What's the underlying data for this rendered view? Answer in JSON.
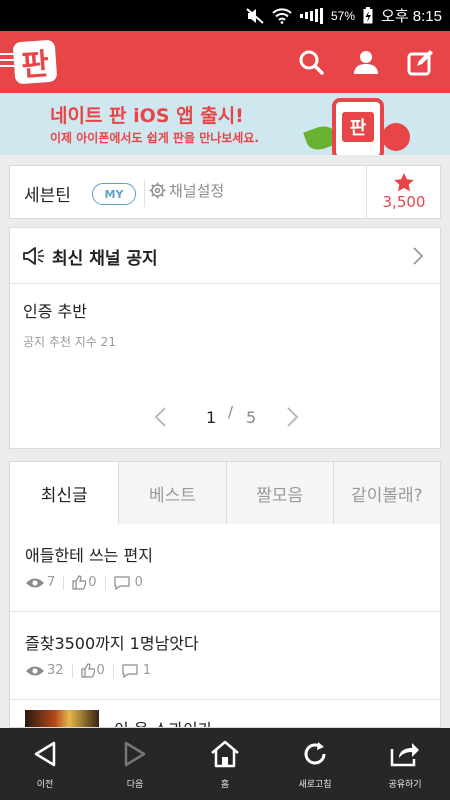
{
  "status_bar": {
    "battery_percent": "57%",
    "time": "오후 8:15",
    "icons": [
      "mute-icon",
      "wifi-icon",
      "signal-icon",
      "battery-charging-icon"
    ]
  },
  "header": {
    "logo_text": "판",
    "icons": [
      "menu-icon",
      "search-icon",
      "user-icon",
      "write-icon"
    ],
    "accent_color": "#e84548"
  },
  "banner": {
    "title": "네이트 판 iOS 앱 출시!",
    "subtitle": "이제 아이폰에서도 쉽게 판을 만나보세요.",
    "phone_logo_text": "판",
    "background_color": "#cfe7ee"
  },
  "channel": {
    "name": "세븐틴",
    "my_badge": "MY",
    "settings_label": "채널설정",
    "favorite_count": "3,500"
  },
  "notice": {
    "title": "최신 채널 공지",
    "post_title": "인증 추반",
    "post_meta": "공지 추천 지수 21",
    "page_current": "1",
    "page_separator": "/",
    "page_total": "5"
  },
  "tabs": [
    {
      "label": "최신글",
      "active": true
    },
    {
      "label": "베스트",
      "active": false
    },
    {
      "label": "짤모음",
      "active": false
    },
    {
      "label": "같이볼래?",
      "active": false
    }
  ],
  "posts": [
    {
      "title": "애들한테 쓰는 편지",
      "views": "7",
      "likes": "0",
      "comments": "0"
    },
    {
      "title": "즐찾3500까지 1명남앗다",
      "views": "32",
      "likes": "0",
      "comments": "1"
    },
    {
      "title": "이 옹 스과이가"
    }
  ],
  "bottom_nav": [
    {
      "label": "이전",
      "icon": "back-icon"
    },
    {
      "label": "다음",
      "icon": "forward-icon"
    },
    {
      "label": "홈",
      "icon": "home-icon"
    },
    {
      "label": "새로고침",
      "icon": "refresh-icon"
    },
    {
      "label": "공유하기",
      "icon": "share-icon"
    }
  ]
}
